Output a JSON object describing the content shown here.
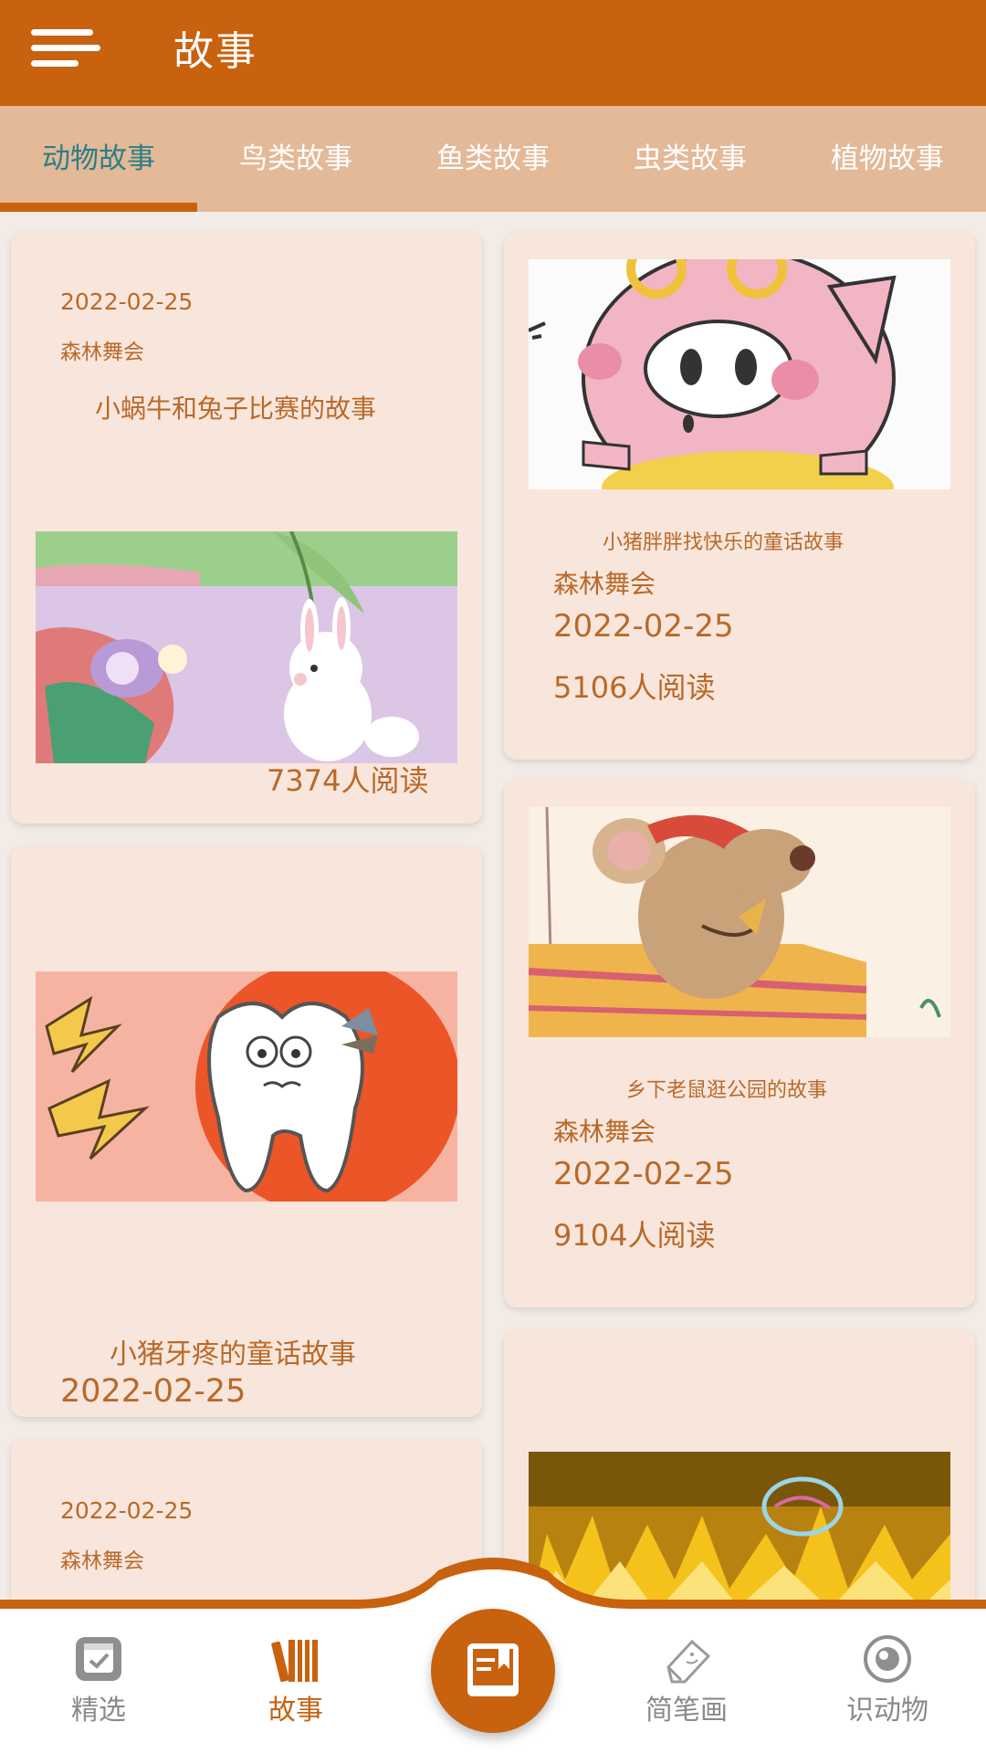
{
  "header": {
    "title": "故事",
    "menu_icon": "menu-icon"
  },
  "tabs": [
    {
      "label": "动物故事",
      "active": true
    },
    {
      "label": "鸟类故事",
      "active": false
    },
    {
      "label": "鱼类故事",
      "active": false
    },
    {
      "label": "虫类故事",
      "active": false
    },
    {
      "label": "植物故事",
      "active": false
    }
  ],
  "stories": [
    {
      "date": "2022-02-25",
      "author": "森林舞会",
      "title": "小蜗牛和兔子比赛的故事",
      "reads": "7374人阅读",
      "image": "snail-and-rabbit"
    },
    {
      "title": "小猪胖胖找快乐的童话故事",
      "author": "森林舞会",
      "date": "2022-02-25",
      "reads": "5106人阅读",
      "image": "pig-with-goggles"
    },
    {
      "title": "小猪牙疼的童话故事",
      "date": "2022-02-25",
      "image": "aching-tooth"
    },
    {
      "title": "乡下老鼠逛公园的故事",
      "author": "森林舞会",
      "date": "2022-02-25",
      "reads": "9104人阅读",
      "image": "mouse-on-cheese"
    },
    {
      "date": "2022-02-25",
      "author": "森林舞会"
    },
    {
      "image": "fire-and-bubble"
    }
  ],
  "bottom_nav": [
    {
      "label": "精选",
      "icon": "calendar-check-icon",
      "active": false
    },
    {
      "label": "故事",
      "icon": "books-icon",
      "active": true
    },
    {
      "label": "",
      "icon": "open-book-icon",
      "active": false
    },
    {
      "label": "简笔画",
      "icon": "eraser-icon",
      "active": false
    },
    {
      "label": "识动物",
      "icon": "eye-icon",
      "active": false
    }
  ],
  "colors": {
    "primary": "#c8620f",
    "tab_bar": "#e3b998",
    "active_tab": "#2a7f86",
    "card": "#f8e6dc",
    "text": "#b9692a"
  }
}
